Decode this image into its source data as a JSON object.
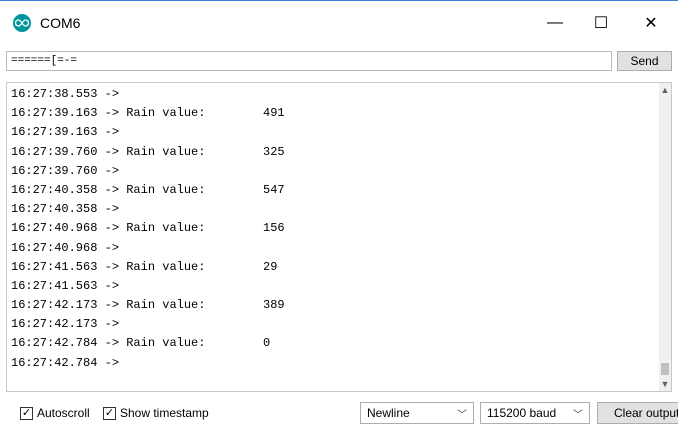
{
  "window": {
    "title": "COM6",
    "minimize_glyph": "—",
    "maximize_glyph": "☐",
    "close_glyph": "✕"
  },
  "toolbar": {
    "input_value": "======[=-=",
    "send_label": "Send"
  },
  "output": {
    "lines": [
      {
        "time": "16:27:38.553 ->",
        "label": "",
        "value": ""
      },
      {
        "time": "16:27:39.163 ->",
        "label": " Rain value:",
        "value": "491"
      },
      {
        "time": "16:27:39.163 ->",
        "label": "",
        "value": ""
      },
      {
        "time": "16:27:39.760 ->",
        "label": " Rain value:",
        "value": "325"
      },
      {
        "time": "16:27:39.760 ->",
        "label": "",
        "value": ""
      },
      {
        "time": "16:27:40.358 ->",
        "label": " Rain value:",
        "value": "547"
      },
      {
        "time": "16:27:40.358 ->",
        "label": "",
        "value": ""
      },
      {
        "time": "16:27:40.968 ->",
        "label": " Rain value:",
        "value": "156"
      },
      {
        "time": "16:27:40.968 ->",
        "label": "",
        "value": ""
      },
      {
        "time": "16:27:41.563 ->",
        "label": " Rain value:",
        "value": "29"
      },
      {
        "time": "16:27:41.563 ->",
        "label": "",
        "value": ""
      },
      {
        "time": "16:27:42.173 ->",
        "label": " Rain value:",
        "value": "389"
      },
      {
        "time": "16:27:42.173 ->",
        "label": "",
        "value": ""
      },
      {
        "time": "16:27:42.784 ->",
        "label": " Rain value:",
        "value": "0"
      },
      {
        "time": "16:27:42.784 ->",
        "label": "",
        "value": ""
      }
    ]
  },
  "statusbar": {
    "autoscroll_label": "Autoscroll",
    "autoscroll_checked": true,
    "timestamp_label": "Show timestamp",
    "timestamp_checked": true,
    "line_ending": "Newline",
    "baud_rate": "115200 baud",
    "clear_label": "Clear output"
  },
  "colors": {
    "accent": "#00979c",
    "title_border": "#3a7bd5"
  },
  "icons": {
    "app": "arduino-infinity-icon",
    "caret": "chevron-down-icon"
  }
}
